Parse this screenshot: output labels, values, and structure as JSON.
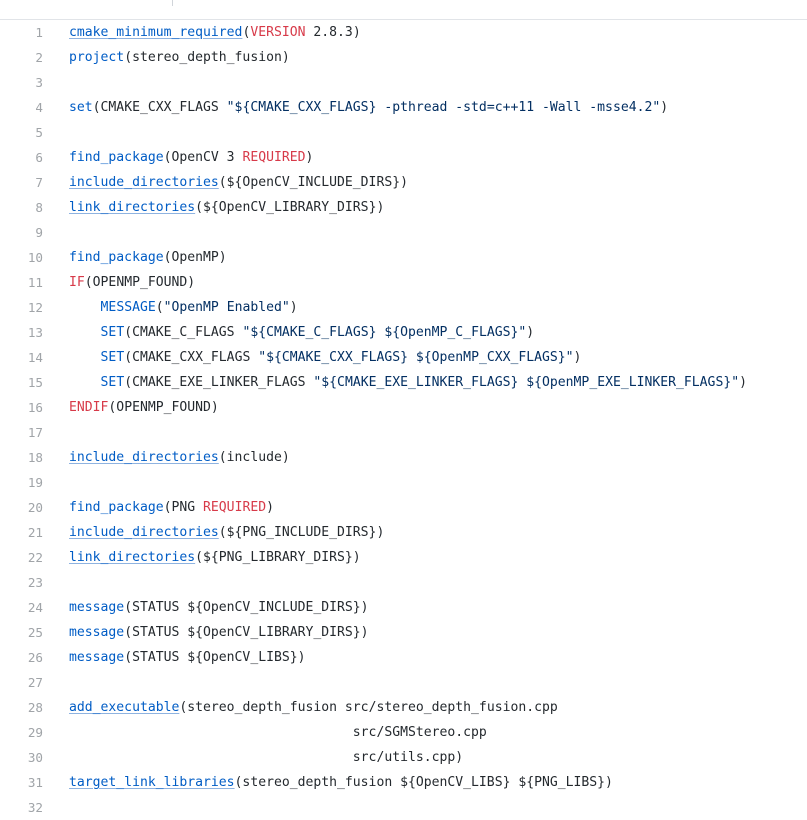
{
  "lines": [
    {
      "n": "1",
      "t": [
        {
          "c": "func",
          "u": true,
          "s": "cmake_minimum_required"
        },
        {
          "c": "plain",
          "s": "("
        },
        {
          "c": "kw",
          "s": "VERSION"
        },
        {
          "c": "plain",
          "s": " 2.8.3)"
        }
      ]
    },
    {
      "n": "2",
      "t": [
        {
          "c": "func",
          "s": "project"
        },
        {
          "c": "plain",
          "s": "(stereo_depth_fusion)"
        }
      ]
    },
    {
      "n": "3",
      "t": []
    },
    {
      "n": "4",
      "t": [
        {
          "c": "func",
          "s": "set"
        },
        {
          "c": "plain",
          "s": "(CMAKE_CXX_FLAGS "
        },
        {
          "c": "str",
          "s": "\"${CMAKE_CXX_FLAGS} -pthread -std=c++11 -Wall -msse4.2\""
        },
        {
          "c": "plain",
          "s": ")"
        }
      ]
    },
    {
      "n": "5",
      "t": []
    },
    {
      "n": "6",
      "t": [
        {
          "c": "func",
          "s": "find_package"
        },
        {
          "c": "plain",
          "s": "(OpenCV 3 "
        },
        {
          "c": "kw",
          "s": "REQUIRED"
        },
        {
          "c": "plain",
          "s": ")"
        }
      ]
    },
    {
      "n": "7",
      "t": [
        {
          "c": "func",
          "u": true,
          "s": "include_directories"
        },
        {
          "c": "plain",
          "s": "(${OpenCV_INCLUDE_DIRS})"
        }
      ]
    },
    {
      "n": "8",
      "t": [
        {
          "c": "func",
          "u": true,
          "s": "link_directories"
        },
        {
          "c": "plain",
          "s": "(${OpenCV_LIBRARY_DIRS})"
        }
      ]
    },
    {
      "n": "9",
      "t": []
    },
    {
      "n": "10",
      "t": [
        {
          "c": "func",
          "s": "find_package"
        },
        {
          "c": "plain",
          "s": "(OpenMP)"
        }
      ]
    },
    {
      "n": "11",
      "t": [
        {
          "c": "kw",
          "s": "IF"
        },
        {
          "c": "plain",
          "s": "(OPENMP_FOUND)"
        }
      ]
    },
    {
      "n": "12",
      "t": [
        {
          "c": "plain",
          "s": "    "
        },
        {
          "c": "func",
          "s": "MESSAGE"
        },
        {
          "c": "plain",
          "s": "("
        },
        {
          "c": "str",
          "s": "\"OpenMP Enabled\""
        },
        {
          "c": "plain",
          "s": ")"
        }
      ]
    },
    {
      "n": "13",
      "t": [
        {
          "c": "plain",
          "s": "    "
        },
        {
          "c": "func",
          "s": "SET"
        },
        {
          "c": "plain",
          "s": "(CMAKE_C_FLAGS "
        },
        {
          "c": "str",
          "s": "\"${CMAKE_C_FLAGS} ${OpenMP_C_FLAGS}\""
        },
        {
          "c": "plain",
          "s": ")"
        }
      ]
    },
    {
      "n": "14",
      "t": [
        {
          "c": "plain",
          "s": "    "
        },
        {
          "c": "func",
          "s": "SET"
        },
        {
          "c": "plain",
          "s": "(CMAKE_CXX_FLAGS "
        },
        {
          "c": "str",
          "s": "\"${CMAKE_CXX_FLAGS} ${OpenMP_CXX_FLAGS}\""
        },
        {
          "c": "plain",
          "s": ")"
        }
      ]
    },
    {
      "n": "15",
      "t": [
        {
          "c": "plain",
          "s": "    "
        },
        {
          "c": "func",
          "s": "SET"
        },
        {
          "c": "plain",
          "s": "(CMAKE_EXE_LINKER_FLAGS "
        },
        {
          "c": "str",
          "s": "\"${CMAKE_EXE_LINKER_FLAGS} ${OpenMP_EXE_LINKER_FLAGS}\""
        },
        {
          "c": "plain",
          "s": ")"
        }
      ]
    },
    {
      "n": "16",
      "t": [
        {
          "c": "kw",
          "s": "ENDIF"
        },
        {
          "c": "plain",
          "s": "(OPENMP_FOUND)"
        }
      ]
    },
    {
      "n": "17",
      "t": []
    },
    {
      "n": "18",
      "t": [
        {
          "c": "func",
          "u": true,
          "s": "include_directories"
        },
        {
          "c": "plain",
          "s": "(include)"
        }
      ]
    },
    {
      "n": "19",
      "t": []
    },
    {
      "n": "20",
      "t": [
        {
          "c": "func",
          "s": "find_package"
        },
        {
          "c": "plain",
          "s": "(PNG "
        },
        {
          "c": "kw",
          "s": "REQUIRED"
        },
        {
          "c": "plain",
          "s": ")"
        }
      ]
    },
    {
      "n": "21",
      "t": [
        {
          "c": "func",
          "u": true,
          "s": "include_directories"
        },
        {
          "c": "plain",
          "s": "(${PNG_INCLUDE_DIRS})"
        }
      ]
    },
    {
      "n": "22",
      "t": [
        {
          "c": "func",
          "u": true,
          "s": "link_directories"
        },
        {
          "c": "plain",
          "s": "(${PNG_LIBRARY_DIRS})"
        }
      ]
    },
    {
      "n": "23",
      "t": []
    },
    {
      "n": "24",
      "t": [
        {
          "c": "func",
          "s": "message"
        },
        {
          "c": "plain",
          "s": "(STATUS ${OpenCV_INCLUDE_DIRS})"
        }
      ]
    },
    {
      "n": "25",
      "t": [
        {
          "c": "func",
          "s": "message"
        },
        {
          "c": "plain",
          "s": "(STATUS ${OpenCV_LIBRARY_DIRS})"
        }
      ]
    },
    {
      "n": "26",
      "t": [
        {
          "c": "func",
          "s": "message"
        },
        {
          "c": "plain",
          "s": "(STATUS ${OpenCV_LIBS})"
        }
      ]
    },
    {
      "n": "27",
      "t": []
    },
    {
      "n": "28",
      "t": [
        {
          "c": "func",
          "u": true,
          "s": "add_executable"
        },
        {
          "c": "plain",
          "s": "(stereo_depth_fusion src/stereo_depth_fusion.cpp"
        }
      ]
    },
    {
      "n": "29",
      "t": [
        {
          "c": "plain",
          "s": "                                    src/SGMStereo.cpp"
        }
      ]
    },
    {
      "n": "30",
      "t": [
        {
          "c": "plain",
          "s": "                                    src/utils.cpp)"
        }
      ]
    },
    {
      "n": "31",
      "t": [
        {
          "c": "func",
          "u": true,
          "s": "target_link_libraries"
        },
        {
          "c": "plain",
          "s": "(stereo_depth_fusion ${OpenCV_LIBS} ${PNG_LIBS})"
        }
      ]
    },
    {
      "n": "32",
      "t": []
    }
  ]
}
